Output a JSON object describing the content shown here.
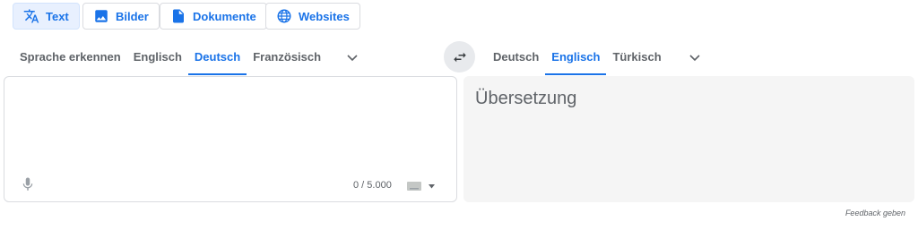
{
  "modes": [
    {
      "label": "Text",
      "icon": "translate-icon"
    },
    {
      "label": "Bilder",
      "icon": "image-icon"
    },
    {
      "label": "Dokumente",
      "icon": "document-icon"
    },
    {
      "label": "Websites",
      "icon": "globe-icon"
    }
  ],
  "source_languages": [
    "Sprache erkennen",
    "Englisch",
    "Deutsch",
    "Französisch"
  ],
  "source_selected": "Deutsch",
  "target_languages": [
    "Deutsch",
    "Englisch",
    "Türkisch"
  ],
  "target_selected": "Englisch",
  "output": {
    "placeholder": "Übersetzung"
  },
  "input": {
    "counter": "0 / 5.000"
  },
  "feedback_label": "Feedback geben",
  "colors": {
    "accent": "#1a73e8",
    "output_bg": "#f5f5f5"
  }
}
